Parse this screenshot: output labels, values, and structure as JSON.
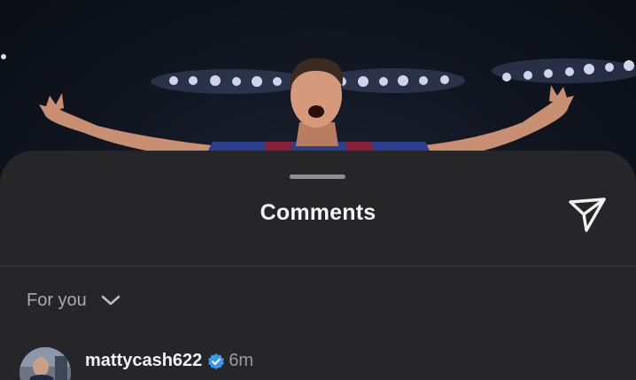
{
  "sheet": {
    "title": "Comments",
    "share_icon": "send-icon"
  },
  "filter": {
    "label": "For you",
    "icon": "chevron-down-icon"
  },
  "comments": [
    {
      "username": "mattycash622",
      "verified": true,
      "timestamp": "6m"
    }
  ],
  "colors": {
    "sheet_background": "#262629",
    "title_text": "#f5f5f5",
    "secondary_text": "#9a9a9f",
    "verified_badge": "#3897f0"
  }
}
